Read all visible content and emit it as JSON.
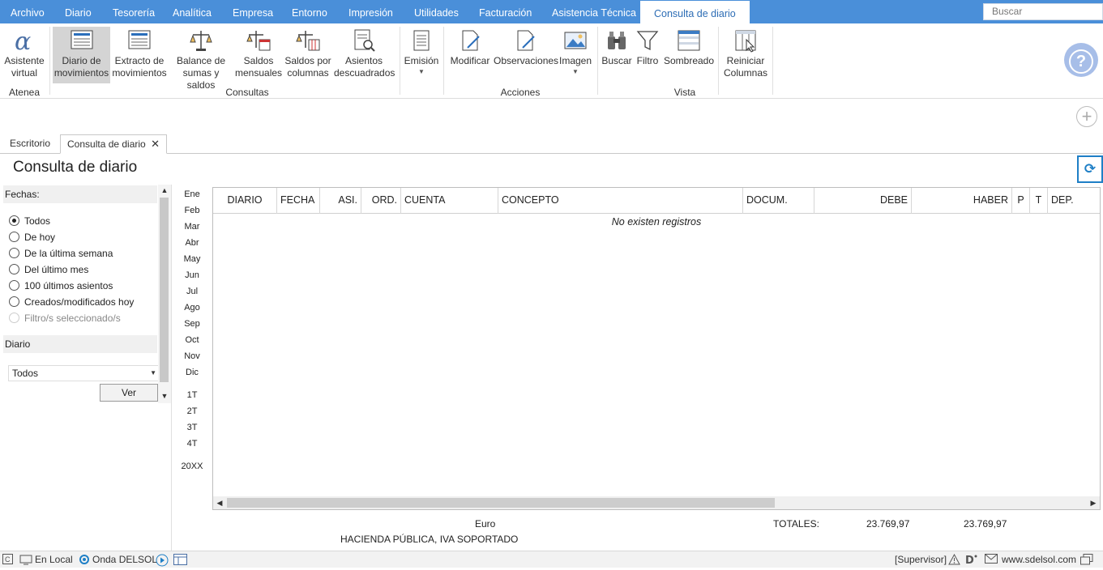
{
  "menu": {
    "items": [
      "Archivo",
      "Diario",
      "Tesorería",
      "Analítica",
      "Empresa",
      "Entorno",
      "Impresión",
      "Utilidades",
      "Facturación",
      "Asistencia Técnica"
    ],
    "active": "Consulta de diario"
  },
  "search": {
    "placeholder": "Buscar"
  },
  "ribbon": {
    "asistente": "Asistente virtual",
    "asistente_l1": "Asistente",
    "asistente_l2": "virtual",
    "atenea_label": "Atenea",
    "consultas_label": "Consultas",
    "acciones_label": "Acciones",
    "vista_label": "Vista",
    "diario_mov_l1": "Diario de",
    "diario_mov_l2": "movimientos",
    "extracto_l1": "Extracto de",
    "extracto_l2": "movimientos",
    "balance_l1": "Balance de",
    "balance_l2": "sumas y saldos",
    "saldos_mens_l1": "Saldos",
    "saldos_mens_l2": "mensuales",
    "saldos_col_l1": "Saldos por",
    "saldos_col_l2": "columnas",
    "asientos_l1": "Asientos",
    "asientos_l2": "descuadrados",
    "emision": "Emisión",
    "modificar": "Modificar",
    "observaciones": "Observaciones",
    "imagen": "Imagen",
    "buscar": "Buscar",
    "filtro": "Filtro",
    "sombreado": "Sombreado",
    "reiniciar_l1": "Reiniciar",
    "reiniciar_l2": "Columnas"
  },
  "tabs": {
    "escritorio": "Escritorio",
    "consulta": "Consulta de diario"
  },
  "page": {
    "title": "Consulta de diario"
  },
  "filters": {
    "fechas_label": "Fechas:",
    "options": [
      "Todos",
      "De hoy",
      "De la última semana",
      "Del último mes",
      "100 últimos asientos",
      "Creados/modificados hoy",
      "Filtro/s seleccionado/s"
    ],
    "selected": "Todos",
    "diario_label": "Diario",
    "diario_value": "Todos",
    "ver_button": "Ver"
  },
  "months": [
    "Ene",
    "Feb",
    "Mar",
    "Abr",
    "May",
    "Jun",
    "Jul",
    "Ago",
    "Sep",
    "Oct",
    "Nov",
    "Dic"
  ],
  "quarters": [
    "1T",
    "2T",
    "3T",
    "4T"
  ],
  "year": "20XX",
  "grid": {
    "columns": [
      "DIARIO",
      "FECHA",
      "ASI.",
      "ORD.",
      "CUENTA",
      "CONCEPTO",
      "DOCUM.",
      "DEBE",
      "HABER",
      "P",
      "T",
      "DEP."
    ],
    "empty_message": "No existen registros"
  },
  "footer": {
    "currency": "Euro",
    "account_name": "HACIENDA PÚBLICA, IVA SOPORTADO",
    "totals_label": "TOTALES:",
    "total_debe": "23.769,97",
    "total_haber": "23.769,97"
  },
  "status": {
    "local": "En Local",
    "onda": "Onda DELSOL",
    "user": "[Supervisor]",
    "website": "www.sdelsol.com"
  },
  "colors": {
    "menu_bg": "#4a8fd9",
    "accent": "#1e7fc6",
    "active_tab_text": "#2d6db5"
  }
}
